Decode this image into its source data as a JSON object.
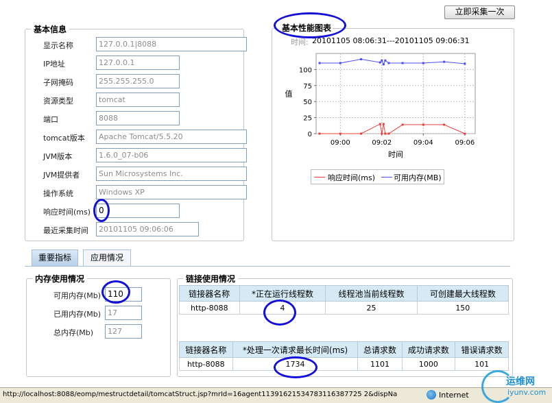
{
  "toolbar": {
    "collect_button": "立即采集一次"
  },
  "basic_info": {
    "title": "基本信息",
    "rows": [
      {
        "label": "显示名称",
        "value": "127.0.0.1|8088"
      },
      {
        "label": "IP地址",
        "value": "127.0.0.1"
      },
      {
        "label": "子网掩码",
        "value": "255.255.255.0"
      },
      {
        "label": "资源类型",
        "value": "tomcat"
      },
      {
        "label": "端口",
        "value": "8088"
      },
      {
        "label": "tomcat版本",
        "value": "Apache Tomcat/5.5.20"
      },
      {
        "label": "JVM版本",
        "value": "1.6.0_07-b06"
      },
      {
        "label": "JVM提供者",
        "value": "Sun Microsystems Inc."
      },
      {
        "label": "操作系统",
        "value": "Windows XP"
      },
      {
        "label": "响应时间(ms)",
        "value": "0"
      },
      {
        "label": "最近采集时间",
        "value": "20101105 09:06:06"
      }
    ]
  },
  "perf_chart": {
    "title": "基本性能图表",
    "time_prefix": "时间:",
    "time_range": "20101105 08:06:31---20101105 09:06:31"
  },
  "chart_data": {
    "type": "line",
    "xlabel": "时间",
    "ylabel": "值",
    "x_ticks": [
      "09:00",
      "09:02",
      "09:04",
      "09:06"
    ],
    "y_ticks": [
      0,
      25,
      50,
      75,
      100
    ],
    "ylim": [
      0,
      125
    ],
    "xlim": [
      "08:58:50",
      "09:06:30"
    ],
    "legend_position": "bottom",
    "series": [
      {
        "name": "响应时间(ms)",
        "color": "#e8413a",
        "x": [
          "08:59:00",
          "09:00:00",
          "09:01:00",
          "09:01:55",
          "09:02:00",
          "09:02:05",
          "09:02:10",
          "09:02:20",
          "09:03:00",
          "09:04:00",
          "09:05:00",
          "09:06:00"
        ],
        "values": [
          0,
          0,
          0,
          15,
          0,
          15,
          0,
          0,
          14,
          14,
          14,
          0
        ]
      },
      {
        "name": "可用内存(MB)",
        "color": "#4a4df0",
        "x": [
          "08:59:00",
          "09:00:00",
          "09:01:00",
          "09:01:55",
          "09:02:00",
          "09:02:05",
          "09:02:10",
          "09:02:20",
          "09:03:00",
          "09:04:00",
          "09:05:00",
          "09:06:00"
        ],
        "values": [
          110,
          110,
          116,
          111,
          114,
          108,
          114,
          110,
          110,
          110,
          112,
          109
        ]
      }
    ]
  },
  "tabs": [
    {
      "label": "重要指标"
    },
    {
      "label": "应用情况"
    }
  ],
  "memory": {
    "title": "内存使用情况",
    "rows": [
      {
        "label": "可用内存(Mb)",
        "value": "110"
      },
      {
        "label": "已用内存(Mb)",
        "value": "17"
      },
      {
        "label": "总内存(Mb)",
        "value": "127"
      }
    ]
  },
  "connectors": {
    "title": "链接使用情况",
    "table1": {
      "headers": [
        "链接器名称",
        "*正在运行线程数",
        "线程池当前线程数",
        "可创建最大线程数"
      ],
      "row": [
        "http-8088",
        "4",
        "25",
        "150"
      ]
    },
    "table2": {
      "headers": [
        "链接器名称",
        "*处理一次请求最长时间(ms)",
        "总请求数",
        "成功请求数",
        "错误请求数"
      ],
      "row": [
        "http-8088",
        "1734",
        "1101",
        "1000",
        "101"
      ]
    }
  },
  "status_bar": {
    "url": "http://localhost:8088/eomp/mestructdetail/tomcatStruct.jsp?mrId=16agent11391621534783116387725 2&dispNa",
    "zone": "Internet",
    "watermark": "运维网",
    "watermark_url": "iyunv.com"
  }
}
